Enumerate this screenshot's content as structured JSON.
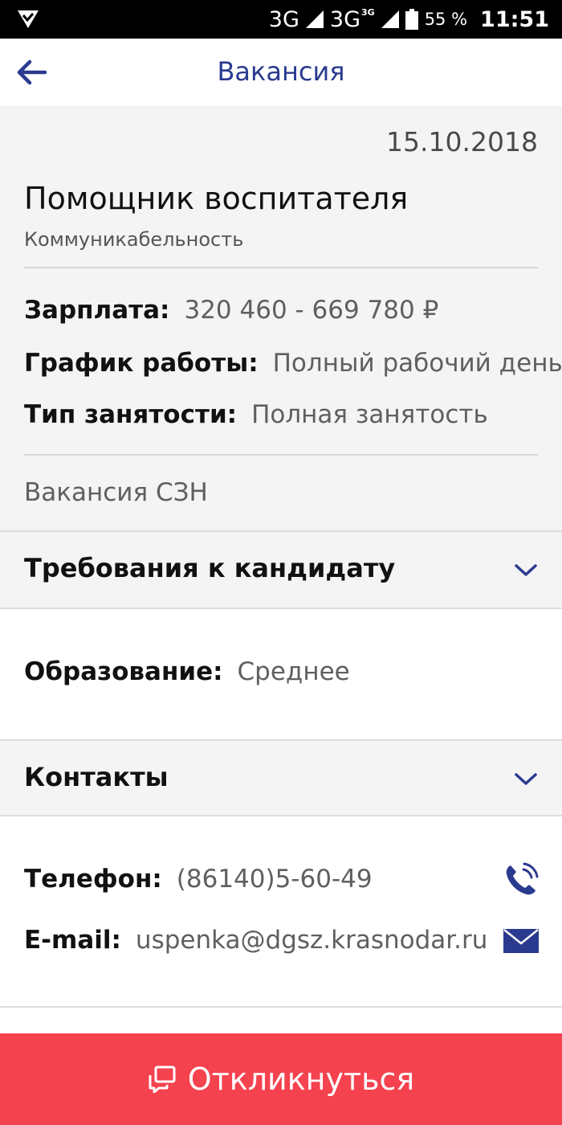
{
  "status_bar": {
    "network1": "3G",
    "network2": "3G",
    "network2_badge": "3G",
    "battery": "55 %",
    "time": "11:51"
  },
  "app_bar": {
    "title": "Вакансия",
    "back_icon": "arrow-left-icon"
  },
  "vacancy": {
    "date": "15.10.2018",
    "title": "Помощник воспитателя",
    "skill": "Коммуникабельность",
    "salary_label": "Зарплата:",
    "salary_value": "320 460 - 669 780 ₽",
    "schedule_label": "График работы:",
    "schedule_value": "Полный рабочий день",
    "employment_label": "Тип занятости:",
    "employment_value": "Полная занятость",
    "source": "Вакансия СЗН"
  },
  "requirements": {
    "heading": "Требования к кандидату",
    "education_label": "Образование:",
    "education_value": "Среднее"
  },
  "contacts": {
    "heading": "Контакты",
    "phone_label": "Телефон:",
    "phone_value": "(86140)5-60-49",
    "email_label": "E-mail:",
    "email_value": "uspenka@dgsz.krasnodar.ru"
  },
  "respond_button": {
    "label": "Откликнуться",
    "icon": "chat-bubbles-icon"
  },
  "colors": {
    "accent": "#2a3a8f",
    "button": "#f5424f"
  }
}
